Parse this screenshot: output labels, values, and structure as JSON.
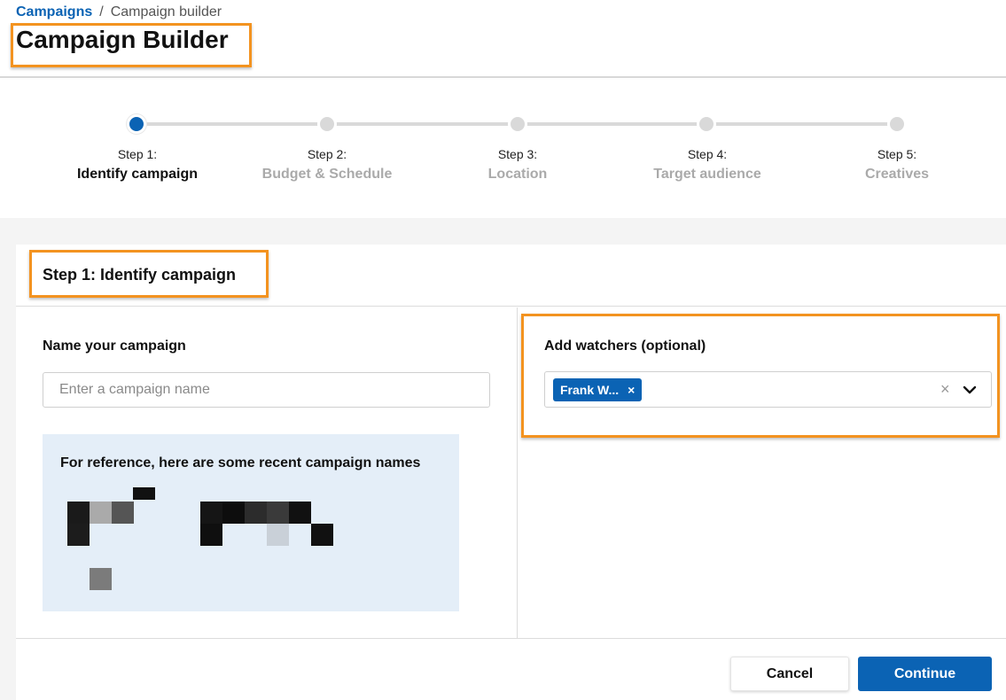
{
  "breadcrumb": {
    "parent": "Campaigns",
    "separator": "/",
    "current": "Campaign builder"
  },
  "page": {
    "title": "Campaign Builder"
  },
  "stepper": {
    "steps": [
      {
        "number": "Step 1:",
        "name": "Identify campaign",
        "active": true
      },
      {
        "number": "Step 2:",
        "name": "Budget & Schedule",
        "active": false
      },
      {
        "number": "Step 3:",
        "name": "Location",
        "active": false
      },
      {
        "number": "Step 4:",
        "name": "Target audience",
        "active": false
      },
      {
        "number": "Step 5:",
        "name": "Creatives",
        "active": false
      }
    ]
  },
  "card": {
    "title": "Step 1: Identify campaign",
    "campaign_name": {
      "label": "Name your campaign",
      "placeholder": "Enter a campaign name",
      "value": ""
    },
    "reference": {
      "title": "For reference, here are some recent campaign names"
    },
    "watchers": {
      "label": "Add watchers (optional)",
      "tags": [
        {
          "label": "Frank W...",
          "remove_icon": "×"
        }
      ],
      "clear_icon": "×",
      "dropdown_icon": "chevron-down-icon"
    },
    "footer": {
      "cancel_label": "Cancel",
      "continue_label": "Continue"
    }
  },
  "colors": {
    "accent": "#0b63b4",
    "highlight": "#f39320",
    "reference_bg": "#e4eef8"
  }
}
